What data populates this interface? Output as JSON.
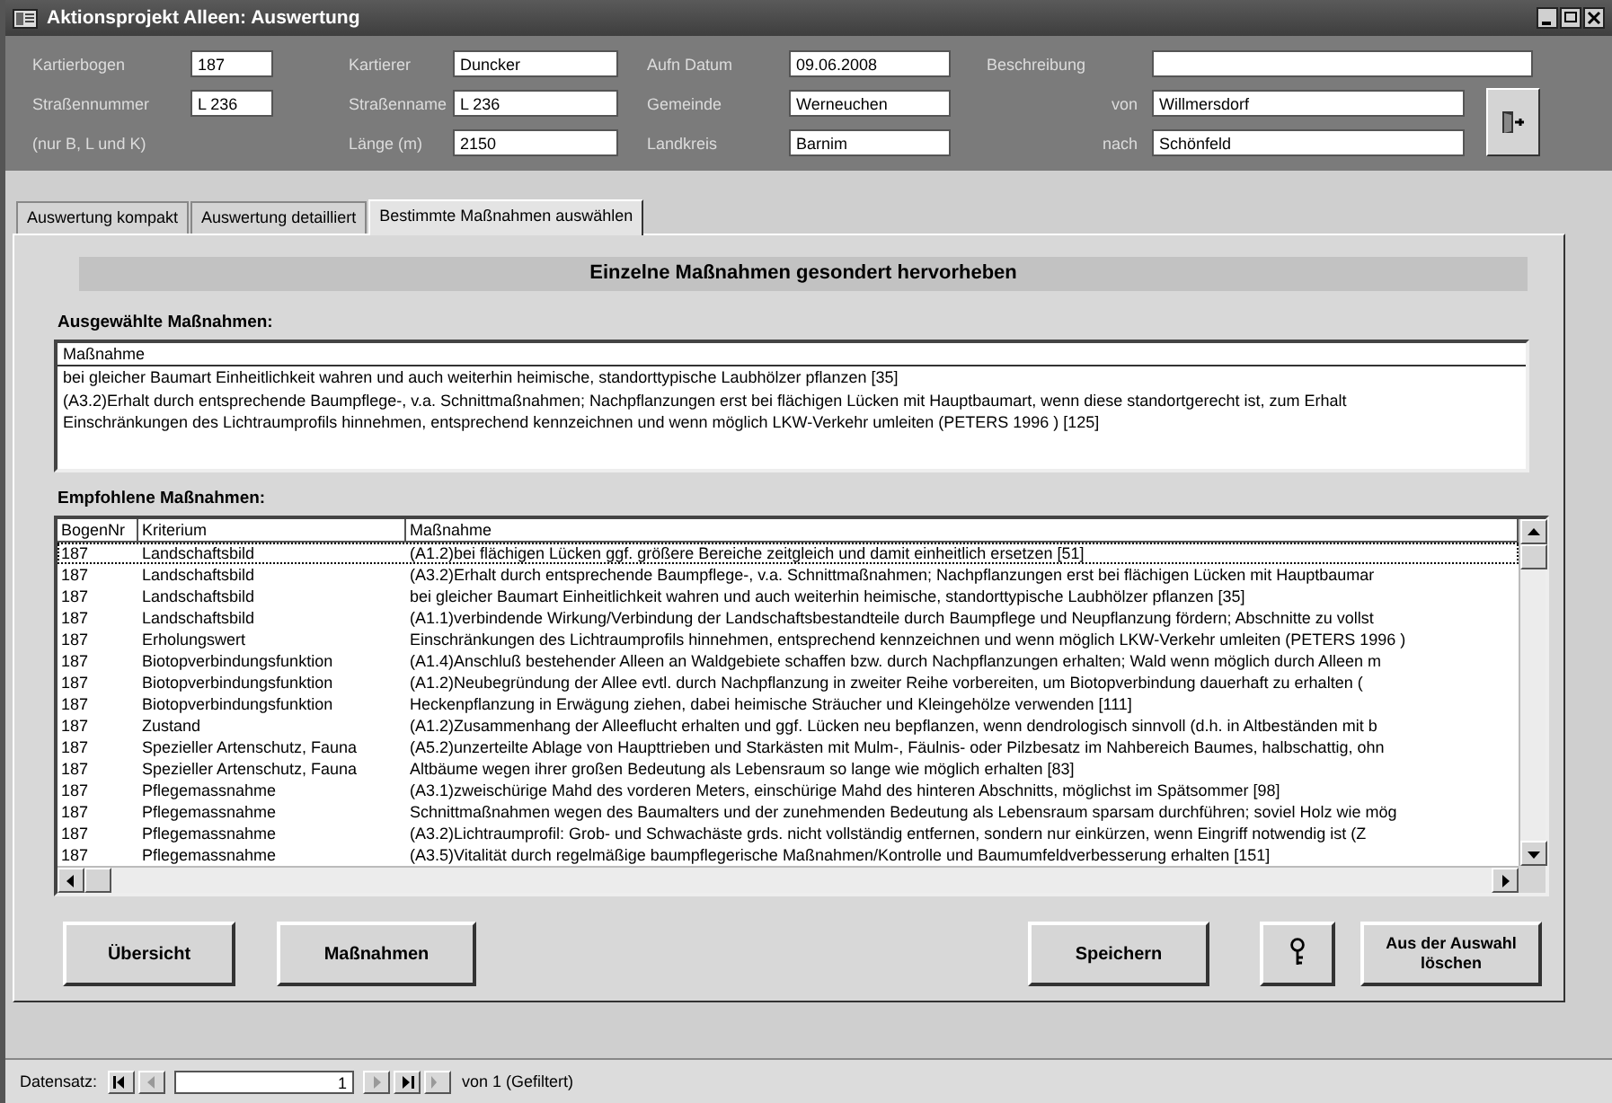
{
  "window": {
    "title": "Aktionsprojekt Alleen: Auswertung"
  },
  "header": {
    "rows": [
      [
        {
          "kind": "field",
          "label": "Kartierbogen",
          "value": "187"
        },
        {
          "kind": "field",
          "label": "Kartierer",
          "value": "Duncker"
        },
        {
          "kind": "field",
          "label": "Aufn Datum",
          "value": "09.06.2008"
        },
        {
          "kind": "field",
          "label": "Beschreibung"
        }
      ],
      [
        {
          "kind": "field",
          "label": "Straßennummer",
          "value": "L 236"
        },
        {
          "kind": "field",
          "label": "Straßenname",
          "value": "L 236"
        },
        {
          "kind": "field",
          "label": "Gemeinde",
          "value": "Werneuchen"
        },
        {
          "kind": "field",
          "label": "von",
          "value": "Willmersdorf"
        }
      ],
      [
        {
          "kind": "note",
          "label": "(nur B, L und K)"
        },
        {
          "kind": "field",
          "label": "Länge (m)",
          "value": "2150"
        },
        {
          "kind": "field",
          "label": "Landkreis",
          "value": "Barnim"
        },
        {
          "kind": "field",
          "label": "nach",
          "value": "Schönfeld"
        }
      ]
    ]
  },
  "tabs": [
    {
      "label": "Auswertung kompakt",
      "selected": false
    },
    {
      "label": "Auswertung detailliert",
      "selected": false
    },
    {
      "label": "Bestimmte Maßnahmen auswählen",
      "selected": true
    }
  ],
  "page_heading": "Einzelne Maßnahmen gesondert hervorheben",
  "selected_measures": {
    "title": "Ausgewählte Maßnahmen:",
    "column": "Maßnahme",
    "rows": [
      "bei gleicher Baumart Einheitlichkeit wahren und auch weiterhin heimische, standorttypische Laubhölzer pflanzen [35]",
      "(A3.2)Erhalt durch entsprechende Baumpflege-, v.a. Schnittmaßnahmen; Nachpflanzungen erst bei  flächigen Lücken  mit Hauptbaumart, wenn diese standortgerecht ist, zum Erhalt",
      "Einschränkungen des Lichtraumprofils hinnehmen, entsprechend kennzeichnen und wenn möglich LKW-Verkehr umleiten (PETERS 1996 ) [125]"
    ]
  },
  "recommended_measures": {
    "title": "Empfohlene Maßnahmen:",
    "columns": [
      "BogenNr",
      "Kriterium",
      "Maßnahme"
    ],
    "rows": [
      {
        "selected": true,
        "cells": [
          "187",
          "Landschaftsbild",
          "(A1.2)bei flächigen Lücken ggf. größere Bereiche zeitgleich und damit einheitlich ersetzen [51]"
        ]
      },
      {
        "selected": false,
        "cells": [
          "187",
          "Landschaftsbild",
          "(A3.2)Erhalt durch entsprechende Baumpflege-, v.a. Schnittmaßnahmen; Nachpflanzungen erst bei  flächigen Lücken  mit Hauptbaumar"
        ]
      },
      {
        "selected": false,
        "cells": [
          "187",
          "Landschaftsbild",
          "bei gleicher Baumart Einheitlichkeit wahren und auch weiterhin heimische, standorttypische Laubhölzer pflanzen [35]"
        ]
      },
      {
        "selected": false,
        "cells": [
          "187",
          "Landschaftsbild",
          "(A1.1)verbindende Wirkung/Verbindung der Landschaftsbestandteile durch Baumpflege und Neupflanzung fördern; Abschnitte zu vollst"
        ]
      },
      {
        "selected": false,
        "cells": [
          "187",
          "Erholungswert",
          "Einschränkungen des Lichtraumprofils hinnehmen, entsprechend kennzeichnen und wenn möglich LKW-Verkehr umleiten (PETERS 1996 )"
        ]
      },
      {
        "selected": false,
        "cells": [
          "187",
          "Biotopverbindungsfunktion",
          "(A1.4)Anschluß bestehender Alleen an Waldgebiete schaffen bzw. durch Nachpflanzungen erhalten; Wald wenn möglich durch Alleen m"
        ]
      },
      {
        "selected": false,
        "cells": [
          "187",
          "Biotopverbindungsfunktion",
          "(A1.2)Neubegründung der Allee evtl. durch  Nachpflanzung in zweiter Reihe vorbereiten, um Biotopverbindung dauerhaft zu erhalten ("
        ]
      },
      {
        "selected": false,
        "cells": [
          "187",
          "Biotopverbindungsfunktion",
          "Heckenpflanzung in Erwägung ziehen, dabei heimische Sträucher und Kleingehölze verwenden [111]"
        ]
      },
      {
        "selected": false,
        "cells": [
          "187",
          "Zustand",
          "(A1.2)Zusammenhang der Alleeflucht erhalten und ggf. Lücken neu bepflanzen, wenn dendrologisch sinnvoll (d.h. in Altbeständen mit b"
        ]
      },
      {
        "selected": false,
        "cells": [
          "187",
          "Spezieller Artenschutz, Fauna",
          "(A5.2)unzerteilte Ablage von Haupttrieben und Starkästen mit Mulm-, Fäulnis- oder Pilzbesatz im Nahbereich Baumes, halbschattig, ohn"
        ]
      },
      {
        "selected": false,
        "cells": [
          "187",
          "Spezieller Artenschutz, Fauna",
          "Altbäume wegen ihrer großen Bedeutung als Lebensraum so lange wie möglich erhalten [83]"
        ]
      },
      {
        "selected": false,
        "cells": [
          "187",
          "Pflegemassnahme",
          "(A3.1)zweischürige Mahd des vorderen Meters, einschürige Mahd des hinteren Abschnitts, möglichst im Spätsommer [98]"
        ]
      },
      {
        "selected": false,
        "cells": [
          "187",
          "Pflegemassnahme",
          "Schnittmaßnahmen wegen des Baumalters und der zunehmenden Bedeutung als Lebensraum sparsam durchführen; soviel Holz wie mög"
        ]
      },
      {
        "selected": false,
        "cells": [
          "187",
          "Pflegemassnahme",
          "(A3.2)Lichtraumprofil: Grob- und Schwachäste grds. nicht vollständig entfernen, sondern nur einkürzen, wenn Eingriff notwendig ist (Z"
        ]
      },
      {
        "selected": false,
        "cells": [
          "187",
          "Pflegemassnahme",
          "(A3.5)Vitalität durch regelmäßige baumpflegerische Maßnahmen/Kontrolle und Baumumfeldverbesserung erhalten [151]"
        ]
      }
    ]
  },
  "buttons_left": [
    {
      "kind": "text",
      "label": "Übersicht"
    },
    {
      "kind": "text",
      "label": "Maßnahmen"
    }
  ],
  "buttons_right": [
    {
      "kind": "text",
      "label": "Speichern"
    },
    {
      "kind": "icon"
    },
    {
      "kind": "text",
      "label": "Aus der Auswahl löschen"
    }
  ],
  "record_nav": {
    "label": "Datensatz:",
    "current": "1",
    "total": "von 1 (Gefiltert)"
  }
}
